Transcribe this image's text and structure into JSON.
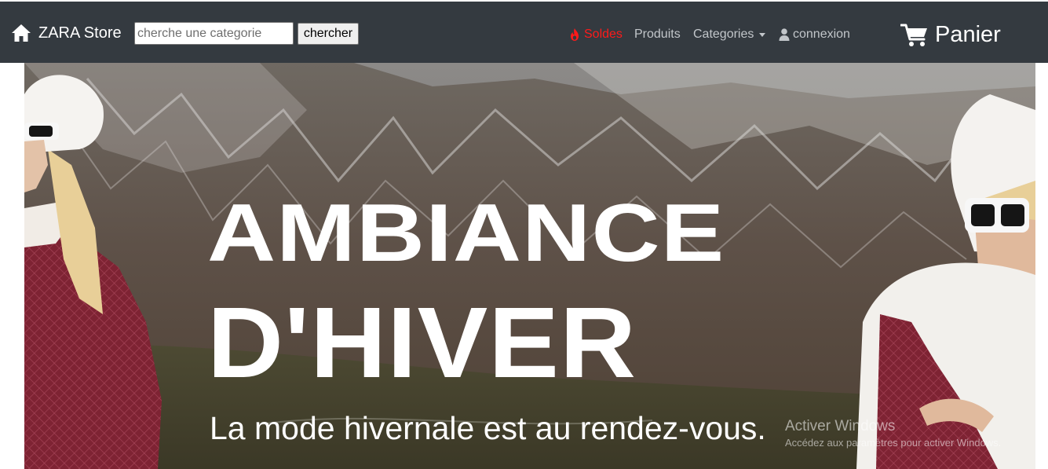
{
  "navbar": {
    "brand": "ZARA Store",
    "search": {
      "placeholder": "cherche une categorie",
      "value": "",
      "button_label": "chercher"
    },
    "links": {
      "soldes": "Soldes",
      "produits": "Produits",
      "categories": "Categories",
      "connexion": "connexion"
    },
    "cart_label": "Panier",
    "colors": {
      "background": "#343a40",
      "soldes": "#ff1a1a",
      "link": "#c2c6ca"
    }
  },
  "hero": {
    "title_line1": "AMBIANCE",
    "title_line2": "D'HIVER",
    "subtitle": "La mode hivernale est au rendez-vous."
  },
  "watermark": {
    "title": "Activer Windows",
    "subtitle": "Accédez aux paramètres pour activer Windows."
  }
}
